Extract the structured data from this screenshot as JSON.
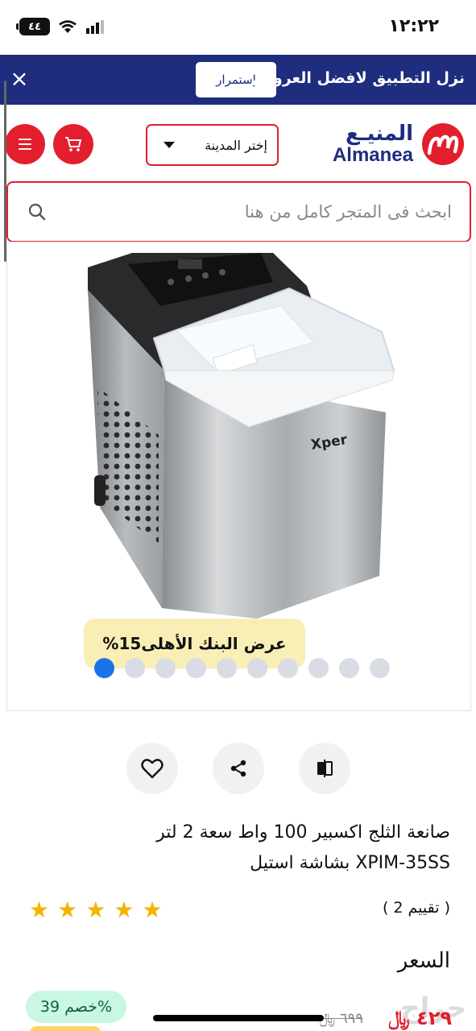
{
  "status_bar": {
    "time": "١٢:٢٢",
    "battery": "٤٤",
    "icons": [
      "battery-icon",
      "wifi-icon",
      "signal-icon"
    ]
  },
  "promo_bar": {
    "text": "نزل التطبيق لافضل العروض",
    "button": "إستمرار",
    "close": "×"
  },
  "header": {
    "logo_ar": "المنيـع",
    "logo_en": "Almanea",
    "city_select": "إختر المدينة",
    "icons": [
      "menu-icon",
      "cart-icon",
      "logo-icon",
      "caret-down-icon"
    ]
  },
  "search": {
    "placeholder": "ابحث فى المتجر كامل من هنا",
    "icon": "search-icon"
  },
  "gallery": {
    "image_brand": "Xper",
    "offer": "%عرض البنك الأهلى15",
    "dots_count": 10,
    "active_dot": 0
  },
  "actions": {
    "icons": [
      "heart-icon",
      "share-icon",
      "compare-icon"
    ]
  },
  "product": {
    "title_line1": "صانعة الثلج اكسبير 100 واط سعة 2 لتر",
    "title_line2": "بشاشة استيل XPIM-35SS",
    "rating_stars": 5,
    "rating_count": "( 2 تقييم )",
    "price_label": "السعر",
    "discount": "خصم 39%",
    "price_now": "٤٢٩",
    "price_old": "٦٩٩",
    "currency": "﷼"
  },
  "watermark": "حراج",
  "colors": {
    "brand_red": "#e31e2d",
    "brand_navy": "#1e2d7e",
    "active_dot": "#1a73e8",
    "star": "#f5b400"
  }
}
